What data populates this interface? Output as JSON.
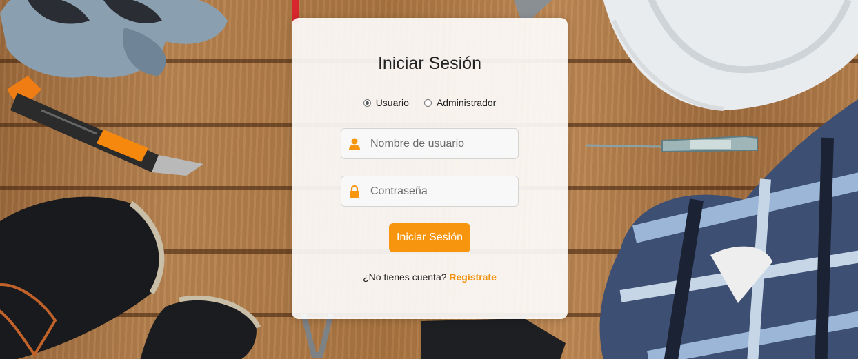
{
  "login": {
    "title": "Iniciar Sesión",
    "roles": [
      {
        "label": "Usuario",
        "selected": true
      },
      {
        "label": "Administrador",
        "selected": false
      }
    ],
    "username": {
      "placeholder": "Nombre de usuario",
      "value": "",
      "icon": "user-icon"
    },
    "password": {
      "placeholder": "Contraseña",
      "value": "",
      "icon": "lock-icon"
    },
    "submit_label": "Iniciar Sesión",
    "signup_prompt": "¿No tienes cuenta?",
    "signup_link": "Regístrate"
  },
  "colors": {
    "accent": "#f7960e",
    "link": "#f0920c",
    "card_bg": "#ffffff"
  }
}
